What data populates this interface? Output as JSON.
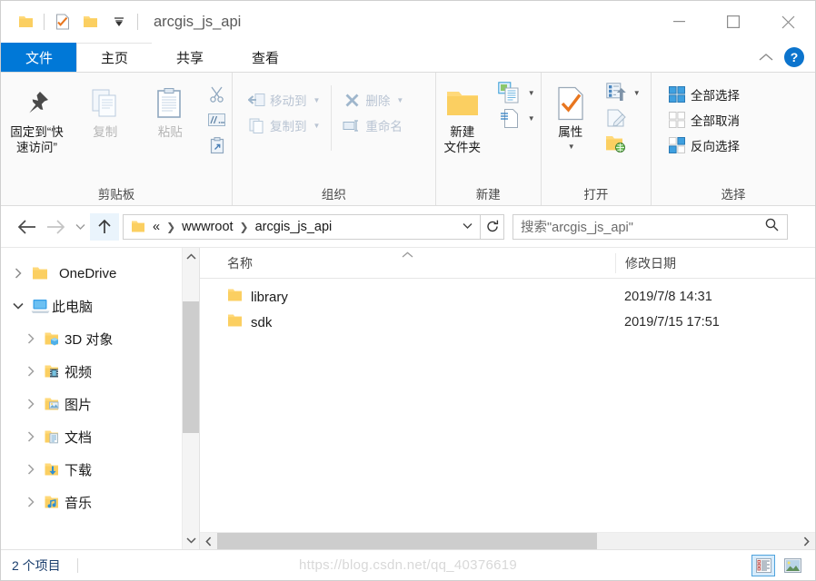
{
  "window": {
    "title": "arcgis_js_api",
    "quick_access": [
      {
        "name": "folder-icon",
        "label": "当前文件夹"
      },
      {
        "name": "properties-icon",
        "label": "属性"
      },
      {
        "name": "new-folder-icon",
        "label": "新建文件夹"
      },
      {
        "name": "customize-dropdown-icon",
        "label": "自定义快速访问工具栏"
      }
    ],
    "controls": {
      "minimize": "最小化",
      "maximize": "最大化",
      "close": "关闭"
    }
  },
  "tabs": [
    {
      "label": "文件",
      "id": "file",
      "active": false
    },
    {
      "label": "主页",
      "id": "home",
      "active": true
    },
    {
      "label": "共享",
      "id": "share",
      "active": false
    },
    {
      "label": "查看",
      "id": "view",
      "active": false
    }
  ],
  "tabbar_right": {
    "collapse_ribbon": "^",
    "help": "?"
  },
  "ribbon": {
    "groups": [
      {
        "title": "剪贴板",
        "big": [
          {
            "label": "固定到“快\n速访问”",
            "icon": "pin-icon",
            "dim": false
          },
          {
            "label": "复制",
            "icon": "copy-icon",
            "dim": true
          },
          {
            "label": "粘贴",
            "icon": "paste-icon",
            "dim": true
          }
        ],
        "small": [
          {
            "label": "",
            "icon": "cut-icon",
            "dim": true
          },
          {
            "label": "",
            "icon": "copy-path-icon",
            "dim": true
          },
          {
            "label": "",
            "icon": "paste-shortcut-icon",
            "dim": true
          }
        ]
      },
      {
        "title": "组织",
        "small": [
          {
            "label": "移动到",
            "icon": "move-to-icon",
            "dim": true,
            "caret": true
          },
          {
            "label": "复制到",
            "icon": "copy-to-icon",
            "dim": true,
            "caret": true
          }
        ],
        "small2": [
          {
            "label": "删除",
            "icon": "delete-icon",
            "dim": true,
            "caret": true
          },
          {
            "label": "重命名",
            "icon": "rename-icon",
            "dim": true,
            "caret": false
          }
        ]
      },
      {
        "title": "新建",
        "big": [
          {
            "label": "新建\n文件夹",
            "icon": "new-folder-icon",
            "dim": false
          }
        ],
        "small": [
          {
            "label": "",
            "icon": "new-item-icon",
            "dim": false,
            "caret": true
          },
          {
            "label": "",
            "icon": "easy-access-icon",
            "dim": false,
            "caret": true
          }
        ]
      },
      {
        "title": "打开",
        "big": [
          {
            "label": "属性",
            "icon": "properties-icon",
            "dim": false,
            "caret": true
          }
        ],
        "small": [
          {
            "label": "",
            "icon": "open-with-icon",
            "dim": false,
            "caret": true
          },
          {
            "label": "",
            "icon": "edit-icon",
            "dim": true,
            "caret": false
          },
          {
            "label": "",
            "icon": "history-icon",
            "dim": false,
            "caret": false
          }
        ]
      },
      {
        "title": "选择",
        "small": [
          {
            "label": "全部选择",
            "icon": "select-all-icon",
            "dim": false
          },
          {
            "label": "全部取消",
            "icon": "select-none-icon",
            "dim": false
          },
          {
            "label": "反向选择",
            "icon": "invert-selection-icon",
            "dim": false
          }
        ]
      }
    ]
  },
  "addressbar": {
    "back": "←",
    "forward": "→",
    "recent": "⌄",
    "up": "↑",
    "breadcrumbs": [
      {
        "label": "«",
        "sep": false
      },
      {
        "label": "wwwroot",
        "sep": true
      },
      {
        "label": "arcgis_js_api",
        "sep": false
      }
    ],
    "dropdown": "⌄",
    "refresh": "↻",
    "search_placeholder": "搜索\"arcgis_js_api\""
  },
  "navpane": {
    "items": [
      {
        "label": "OneDrive",
        "icon": "onedrive-folder-icon",
        "expander": "collapsed",
        "indent": false
      },
      {
        "label": "此电脑",
        "icon": "this-pc-icon",
        "expander": "expanded",
        "indent": false
      },
      {
        "label": "3D 对象",
        "icon": "3d-objects-icon",
        "expander": "collapsed",
        "indent": true
      },
      {
        "label": "视频",
        "icon": "videos-icon",
        "expander": "collapsed",
        "indent": true
      },
      {
        "label": "图片",
        "icon": "pictures-icon",
        "expander": "collapsed",
        "indent": true
      },
      {
        "label": "文档",
        "icon": "documents-icon",
        "expander": "collapsed",
        "indent": true
      },
      {
        "label": "下载",
        "icon": "downloads-icon",
        "expander": "collapsed",
        "indent": true
      },
      {
        "label": "音乐",
        "icon": "music-icon",
        "expander": "collapsed",
        "indent": true
      }
    ]
  },
  "filelist": {
    "columns": [
      {
        "key": "name",
        "label": "名称",
        "sorted": true
      },
      {
        "key": "date",
        "label": "修改日期",
        "sorted": false
      }
    ],
    "rows": [
      {
        "name": "library",
        "date": "2019/7/8 14:31",
        "icon": "folder-icon"
      },
      {
        "name": "sdk",
        "date": "2019/7/15 17:51",
        "icon": "folder-icon"
      }
    ]
  },
  "statusbar": {
    "item_count": "2 个项目",
    "watermark": "https://blog.csdn.net/qq_40376619",
    "views": [
      {
        "name": "details-view-icon",
        "selected": true
      },
      {
        "name": "large-icons-view-icon",
        "selected": false
      }
    ]
  },
  "colors": {
    "accent": "#0078d7",
    "folder": "#ffd166",
    "help_blue": "#0c74cd",
    "selection": "#d6ebfb"
  }
}
